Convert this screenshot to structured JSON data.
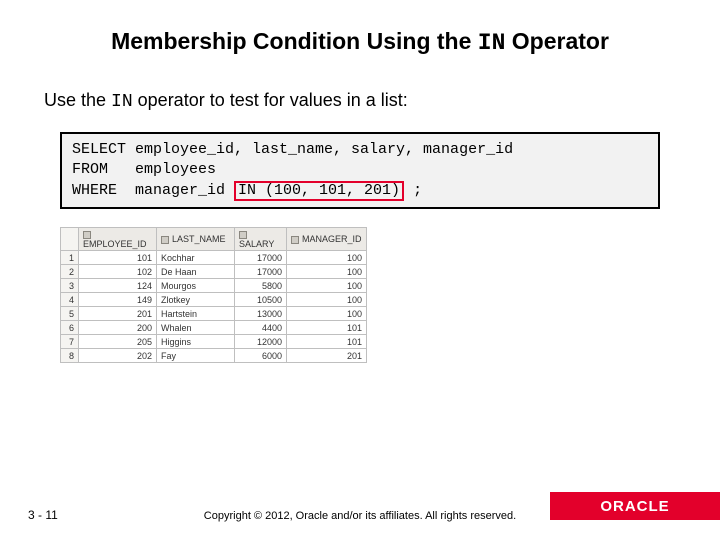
{
  "title_before": "Membership Condition Using the ",
  "title_code": "IN",
  "title_after": " Operator",
  "body_before": "Use the ",
  "body_code": "IN",
  "body_after": " operator to test for values in a list:",
  "sql": {
    "l1": "SELECT employee_id, last_name, salary, manager_id",
    "l2": "FROM   employees",
    "l3a": "WHERE  manager_id ",
    "l3_hl": "IN (100, 101, 201)",
    "l3b": " ;"
  },
  "cols": {
    "emp": "EMPLOYEE_ID",
    "last": "LAST_NAME",
    "sal": "SALARY",
    "mgr": "MANAGER_ID"
  },
  "rows": [
    {
      "n": "1",
      "emp": "101",
      "last": "Kochhar",
      "sal": "17000",
      "mgr": "100"
    },
    {
      "n": "2",
      "emp": "102",
      "last": "De Haan",
      "sal": "17000",
      "mgr": "100"
    },
    {
      "n": "3",
      "emp": "124",
      "last": "Mourgos",
      "sal": "5800",
      "mgr": "100"
    },
    {
      "n": "4",
      "emp": "149",
      "last": "Zlotkey",
      "sal": "10500",
      "mgr": "100"
    },
    {
      "n": "5",
      "emp": "201",
      "last": "Hartstein",
      "sal": "13000",
      "mgr": "100"
    },
    {
      "n": "6",
      "emp": "200",
      "last": "Whalen",
      "sal": "4400",
      "mgr": "101"
    },
    {
      "n": "7",
      "emp": "205",
      "last": "Higgins",
      "sal": "12000",
      "mgr": "101"
    },
    {
      "n": "8",
      "emp": "202",
      "last": "Fay",
      "sal": "6000",
      "mgr": "201"
    }
  ],
  "page_num": "3 - 11",
  "copyright": "Copyright © 2012, Oracle and/or its affiliates. All rights reserved.",
  "logo": "ORACLE"
}
